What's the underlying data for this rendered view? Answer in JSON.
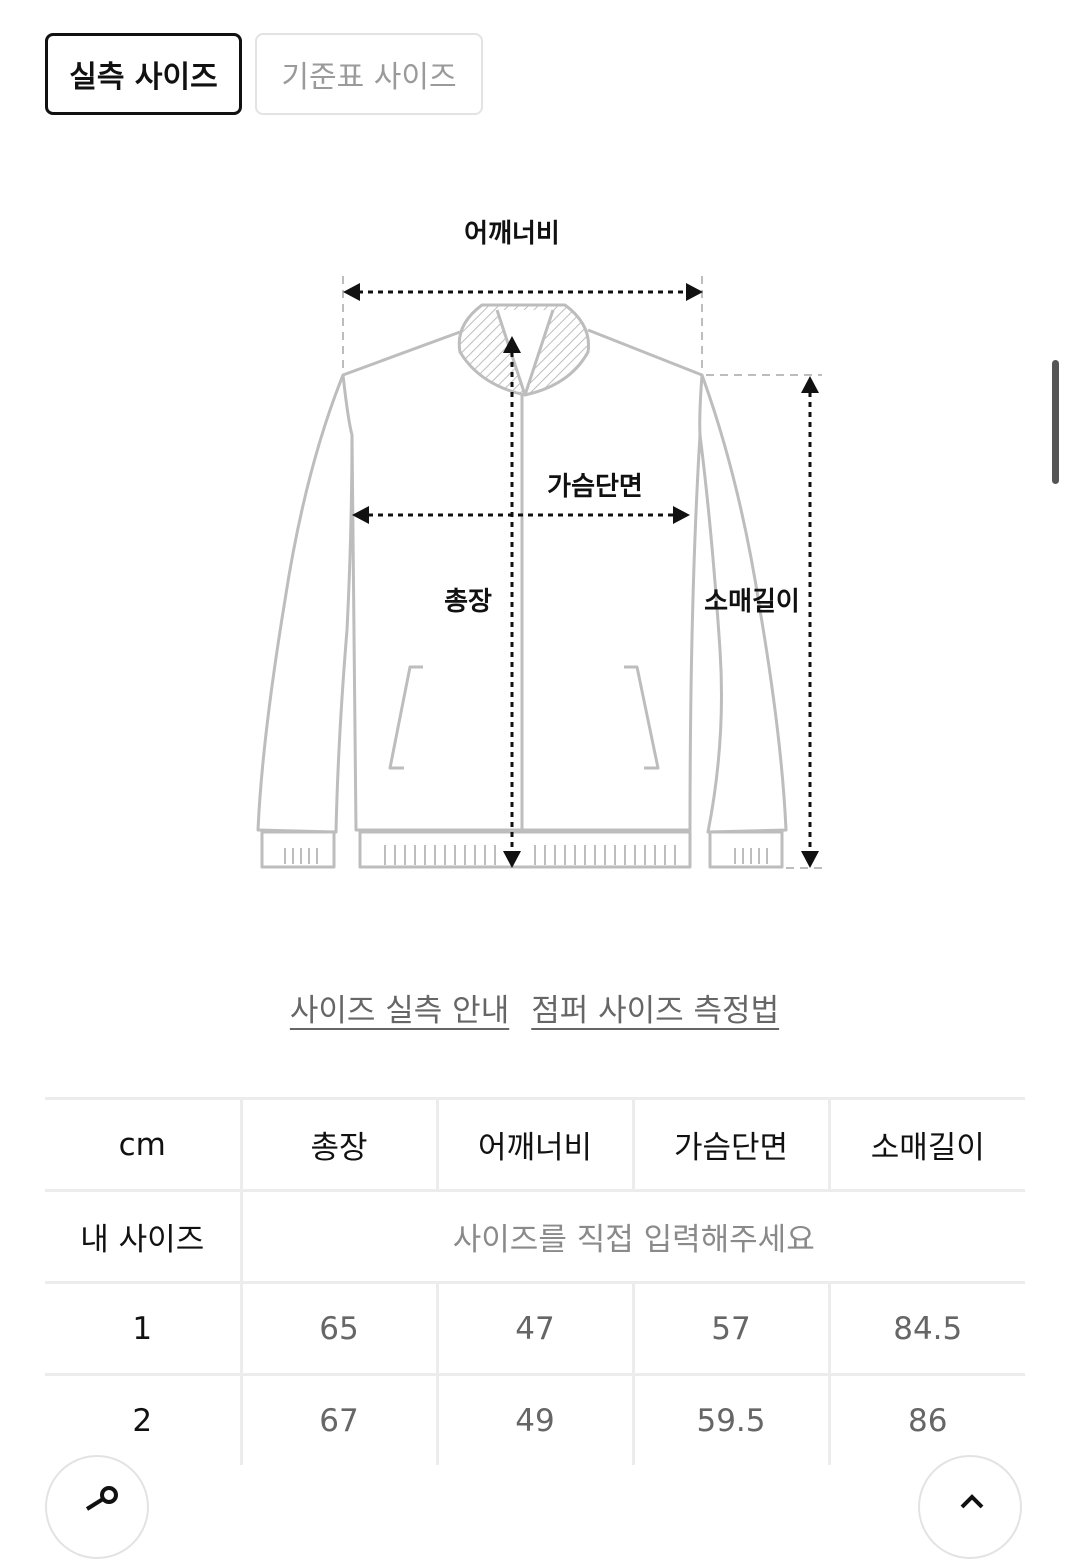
{
  "tabs": [
    {
      "label": "실측 사이즈",
      "active": true
    },
    {
      "label": "기준표 사이즈",
      "active": false
    }
  ],
  "diagram": {
    "labels": {
      "shoulder": "어깨너비",
      "chest": "가슴단면",
      "length": "총장",
      "sleeve": "소매길이"
    }
  },
  "links": [
    {
      "label": "사이즈 실측 안내"
    },
    {
      "label": "점퍼 사이즈 측정법"
    }
  ],
  "table": {
    "unit": "cm",
    "headers": [
      "총장",
      "어깨너비",
      "가슴단면",
      "소매길이"
    ],
    "my_size": {
      "label": "내 사이즈",
      "placeholder": "사이즈를 직접 입력해주세요"
    },
    "rows": [
      {
        "size": "1",
        "values": [
          "65",
          "47",
          "57",
          "84.5"
        ]
      },
      {
        "size": "2",
        "values": [
          "67",
          "49",
          "59.5",
          "86"
        ]
      }
    ]
  },
  "colors": {
    "active_border": "#111111",
    "inactive_border": "#e3e3e3",
    "line": "#ececec"
  }
}
